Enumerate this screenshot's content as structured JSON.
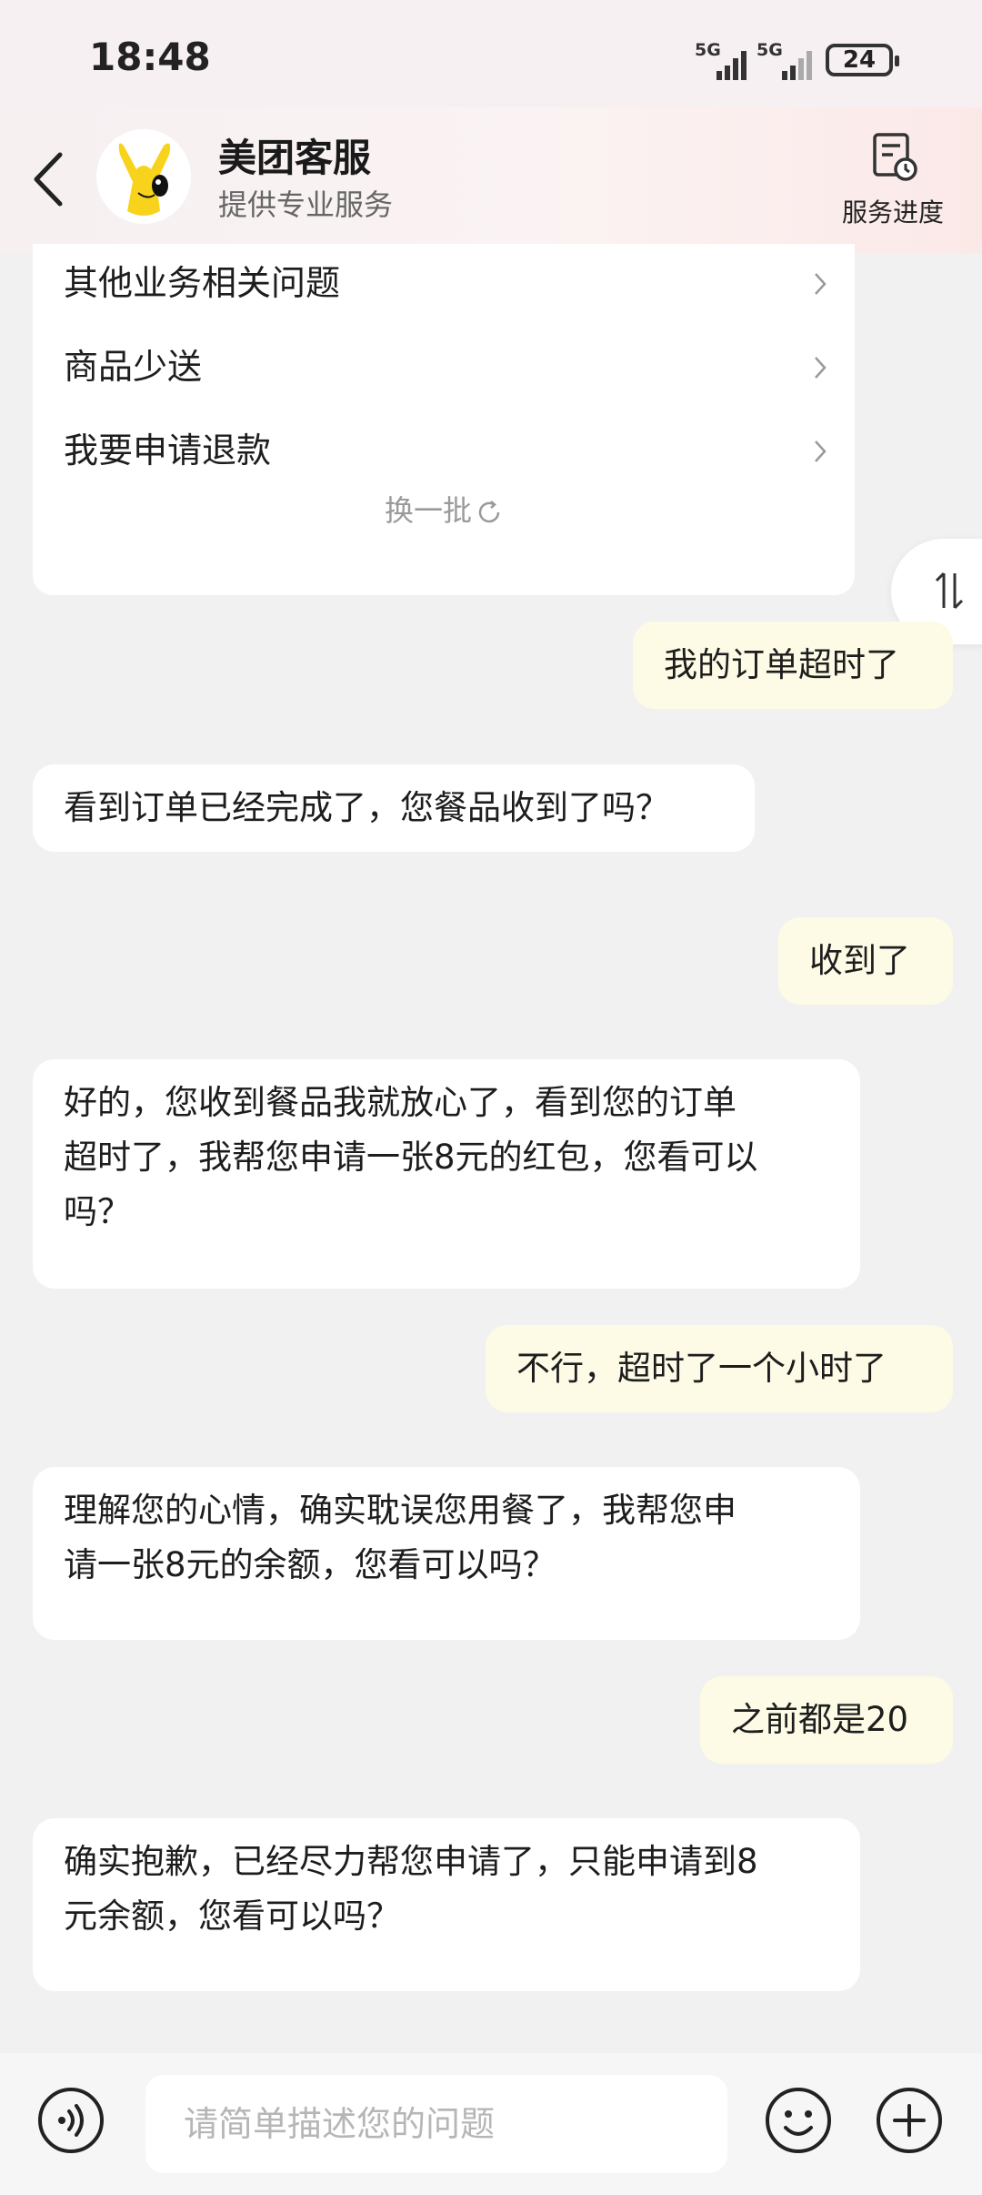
{
  "status_bar": {
    "time": "18:48",
    "signal1": "5G",
    "signal2": "5G",
    "battery": "24"
  },
  "header": {
    "title": "美团客服",
    "subtitle": "提供专业服务",
    "progress_label": "服务进度",
    "icons": [
      "back-icon",
      "avatar-mascot",
      "progress-icon"
    ]
  },
  "quick_questions": {
    "items": [
      {
        "label": "其他业务相关问题"
      },
      {
        "label": "商品少送"
      },
      {
        "label": "我要申请退款"
      }
    ],
    "refresh_label": "换一批"
  },
  "messages": [
    {
      "role": "user",
      "text": "我的订单超时了"
    },
    {
      "role": "bot",
      "text": "看到订单已经完成了，您餐品收到了吗？"
    },
    {
      "role": "user",
      "text": "收到了"
    },
    {
      "role": "bot",
      "text": "好的，您收到餐品我就放心了，看到您的订单\n超时了，我帮您申请一张8元的红包，您看可以\n吗？"
    },
    {
      "role": "user",
      "text": "不行，超时了一个小时了"
    },
    {
      "role": "bot",
      "text": "理解您的心情，确实耽误您用餐了，我帮您申\n请一张8元的余额，您看可以吗？"
    },
    {
      "role": "user",
      "text": "之前都是20"
    },
    {
      "role": "bot",
      "text": "确实抱歉，已经尽力帮您申请了，只能申请到8\n元余额，您看可以吗？"
    }
  ],
  "input": {
    "placeholder": "请简单描述您的问题"
  },
  "colors": {
    "user_bubble": "#fdfbe5",
    "bot_bubble": "#ffffff",
    "background": "#f1f1f1",
    "mascot": "#f7d31b"
  }
}
